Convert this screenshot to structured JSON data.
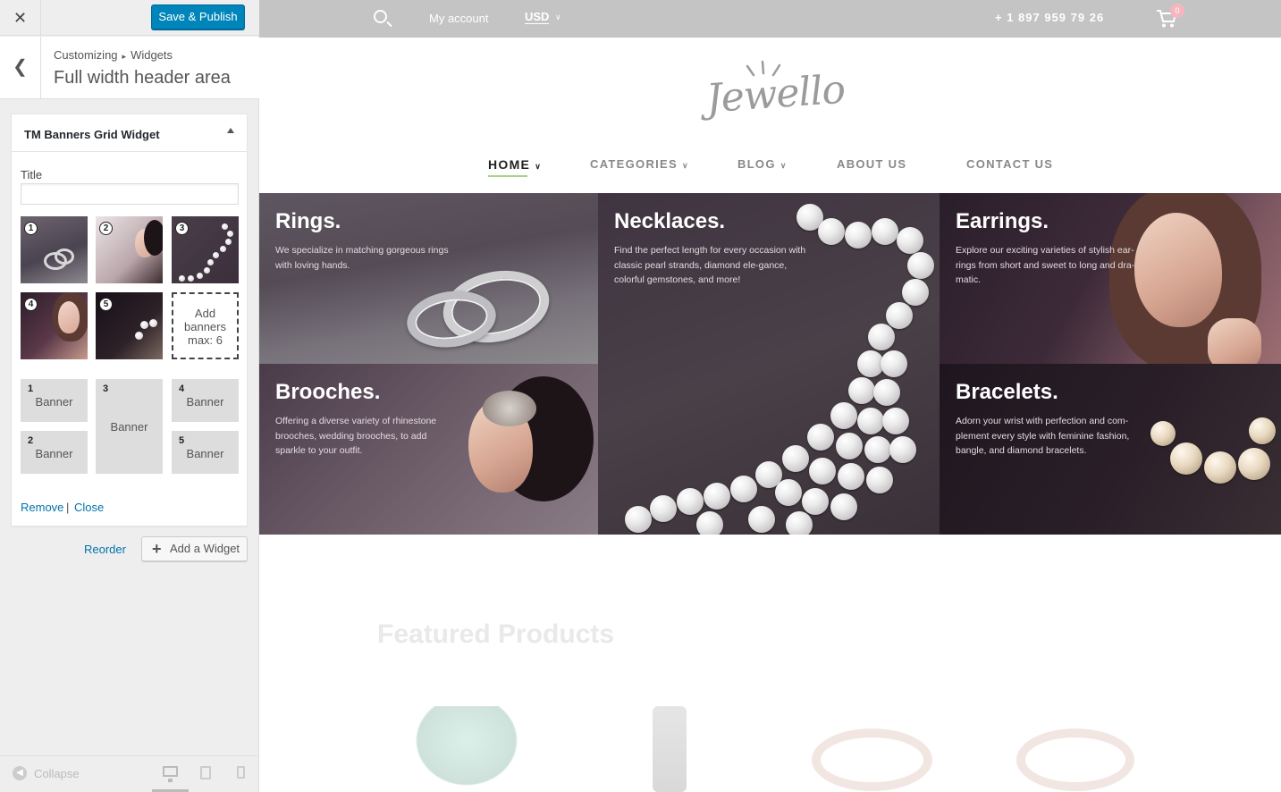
{
  "customizer": {
    "close_label": "✕",
    "save_button": "Save & Publish",
    "breadcrumb": {
      "parent": "Customizing",
      "separator": "▸",
      "child": "Widgets"
    },
    "panel_title": "Full width header area",
    "widget": {
      "title": "TM Banners Grid Widget",
      "field_label": "Title",
      "field_value": "",
      "thumbnails": [
        {
          "num": "1",
          "subject": "rings"
        },
        {
          "num": "2",
          "subject": "brooches"
        },
        {
          "num": "3",
          "subject": "necklaces"
        },
        {
          "num": "4",
          "subject": "earrings"
        },
        {
          "num": "5",
          "subject": "bracelets"
        }
      ],
      "add_banners_text": "Add banners max: 6",
      "layout_slots": [
        {
          "num": "1",
          "label": "Banner"
        },
        {
          "num": "2",
          "label": "Banner"
        },
        {
          "num": "3",
          "label": "Banner"
        },
        {
          "num": "4",
          "label": "Banner"
        },
        {
          "num": "5",
          "label": "Banner"
        }
      ],
      "remove_label": "Remove",
      "separator": "|",
      "close_label": "Close"
    },
    "reorder_label": "Reorder",
    "add_widget_label": "Add a Widget",
    "add_widget_icon": "+",
    "collapse_label": "Collapse",
    "devices": [
      "desktop",
      "tablet",
      "mobile"
    ],
    "accent_color": "#0085ba"
  },
  "site": {
    "topbar": {
      "account_label": "My account",
      "currency": "USD",
      "phone": "+ 1 897 959 79 26",
      "cart_count": "0"
    },
    "logo_text": "Jewello",
    "nav": [
      {
        "label": "HOME",
        "active": true,
        "has_dropdown": true
      },
      {
        "label": "CATEGORIES",
        "active": false,
        "has_dropdown": true
      },
      {
        "label": "BLOG",
        "active": false,
        "has_dropdown": true
      },
      {
        "label": "ABOUT US",
        "active": false,
        "has_dropdown": false
      },
      {
        "label": "CONTACT US",
        "active": false,
        "has_dropdown": false
      }
    ],
    "banners": [
      {
        "title": "Rings.",
        "text": "We specialize in matching gorgeous rings with loving hands."
      },
      {
        "title": "Necklaces.",
        "text": "Find the perfect length for every occasion with classic pearl strands, diamond ele-gance, colorful gemstones, and more!"
      },
      {
        "title": "Earrings.",
        "text": "Explore our exciting varieties of stylish ear-rings from short and sweet to long and dra-matic."
      },
      {
        "title": "Brooches.",
        "text": "Offering a diverse variety of rhinestone brooches, wedding brooches, to add sparkle to your outfit."
      },
      {
        "title": "Bracelets.",
        "text": "Adorn your wrist with perfection and com-plement every style with feminine fashion, bangle, and diamond bracelets."
      }
    ],
    "featured_title": "Featured Products",
    "nav_active_underline_color": "#a6d38a"
  }
}
